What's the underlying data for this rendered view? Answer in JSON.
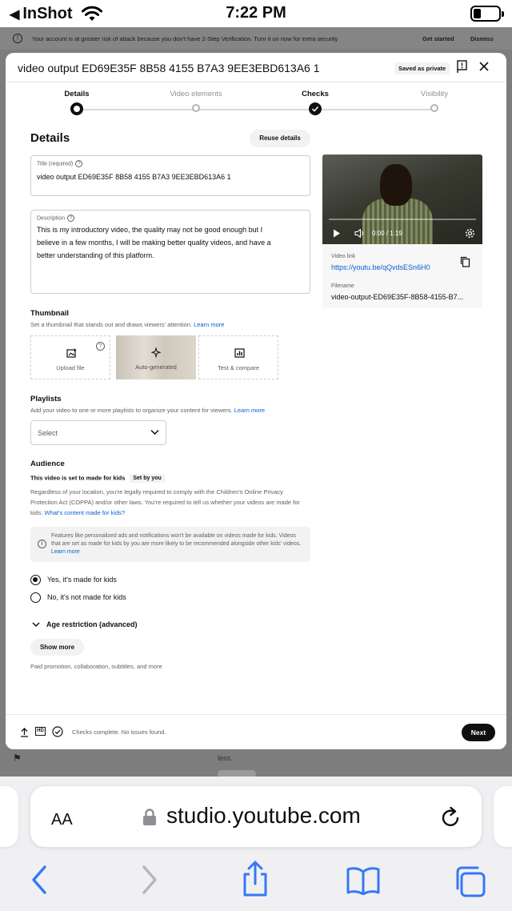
{
  "status_bar": {
    "back_app": "InShot",
    "time": "7:22 PM"
  },
  "banner": {
    "text": "Your account is at greater risk of attack because you don't have 2-Step Verification. Turn it on now for extra security",
    "get_started": "Get started",
    "dismiss": "Dismiss"
  },
  "background_page": {
    "less_text": "less."
  },
  "modal": {
    "title": "video output ED69E35F 8B58 4155 B7A3 9EE3EBD613A6 1",
    "saved_badge": "Saved as private",
    "steps": [
      {
        "label": "Details",
        "state": "active"
      },
      {
        "label": "Video elements",
        "state": "pending"
      },
      {
        "label": "Checks",
        "state": "done"
      },
      {
        "label": "Visibility",
        "state": "pending"
      }
    ],
    "section_title": "Details",
    "reuse_button": "Reuse details",
    "title_field": {
      "label": "Title (required)",
      "value": "video output ED69E35F 8B58 4155 B7A3 9EE3EBD613A6 1"
    },
    "description_field": {
      "label": "Description",
      "lines": [
        "This is my introductory video, the quality may not be good enough but I",
        "believe in a few months, I will be making better quality videos, and have a",
        "better understanding of this platform."
      ]
    },
    "video_preview": {
      "time": "0:00 / 1:19",
      "link_label": "Video link",
      "link": "https://youtu.be/qQvdsESn6H0",
      "filename_label": "Filename",
      "filename": "video-output-ED69E35F-8B58-4155-B7..."
    },
    "thumbnail": {
      "heading": "Thumbnail",
      "subtext": "Set a thumbnail that stands out and draws viewers' attention.",
      "learn_more": "Learn more",
      "options": [
        "Upload file",
        "Auto-generated",
        "Test & compare"
      ],
      "help": "?"
    },
    "playlists": {
      "heading": "Playlists",
      "subtext": "Add your video to one or more playlists to organize your content for viewers.",
      "learn_more": "Learn more",
      "select_value": "Select"
    },
    "audience": {
      "heading": "Audience",
      "set_status": "This video is set to made for kids",
      "set_badge": "Set by you",
      "coppa_text": "Regardless of your location, you're legally required to comply with the Children's Online Privacy Protection Act (COPPA) and/or other laws. You're required to tell us whether your videos are made for kids.",
      "coppa_link": "What's content made for kids?",
      "info_text": "Features like personalized ads and notifications won't be available on videos made for kids. Videos that are set as made for kids by you are more likely to be recommended alongside other kids' videos.",
      "info_link": "Learn more",
      "options": [
        {
          "label": "Yes, it's made for kids",
          "selected": true
        },
        {
          "label": "No, it's not made for kids",
          "selected": false
        }
      ]
    },
    "age_restriction": "Age restriction (advanced)",
    "show_more": "Show more",
    "show_more_caption": "Paid promotion, collaboration, subtitles, and more",
    "footer": {
      "hd_badge": "HD",
      "status": "Checks complete. No issues found.",
      "next": "Next"
    }
  },
  "safari": {
    "aa": "AA",
    "url": "studio.youtube.com"
  },
  "colors": {
    "link": "#065fd4",
    "primary": "#0f0f0f",
    "ios_blue": "#3478f6",
    "dim_overlay": "#7d7d7d"
  },
  "icons": [
    "back-triangle-icon",
    "wifi-icon",
    "battery-icon",
    "info-icon",
    "feedback-flag-icon",
    "close-icon",
    "help-icon",
    "play-icon",
    "volume-icon",
    "settings-gear-icon",
    "copy-icon",
    "upload-image-icon",
    "sparkle-icon",
    "bar-chart-icon",
    "chevron-down-icon",
    "upload-icon",
    "check-circle-icon",
    "lock-icon",
    "reload-icon",
    "back-arrow-icon",
    "forward-arrow-icon",
    "share-icon",
    "bookmarks-icon",
    "tabs-icon"
  ]
}
